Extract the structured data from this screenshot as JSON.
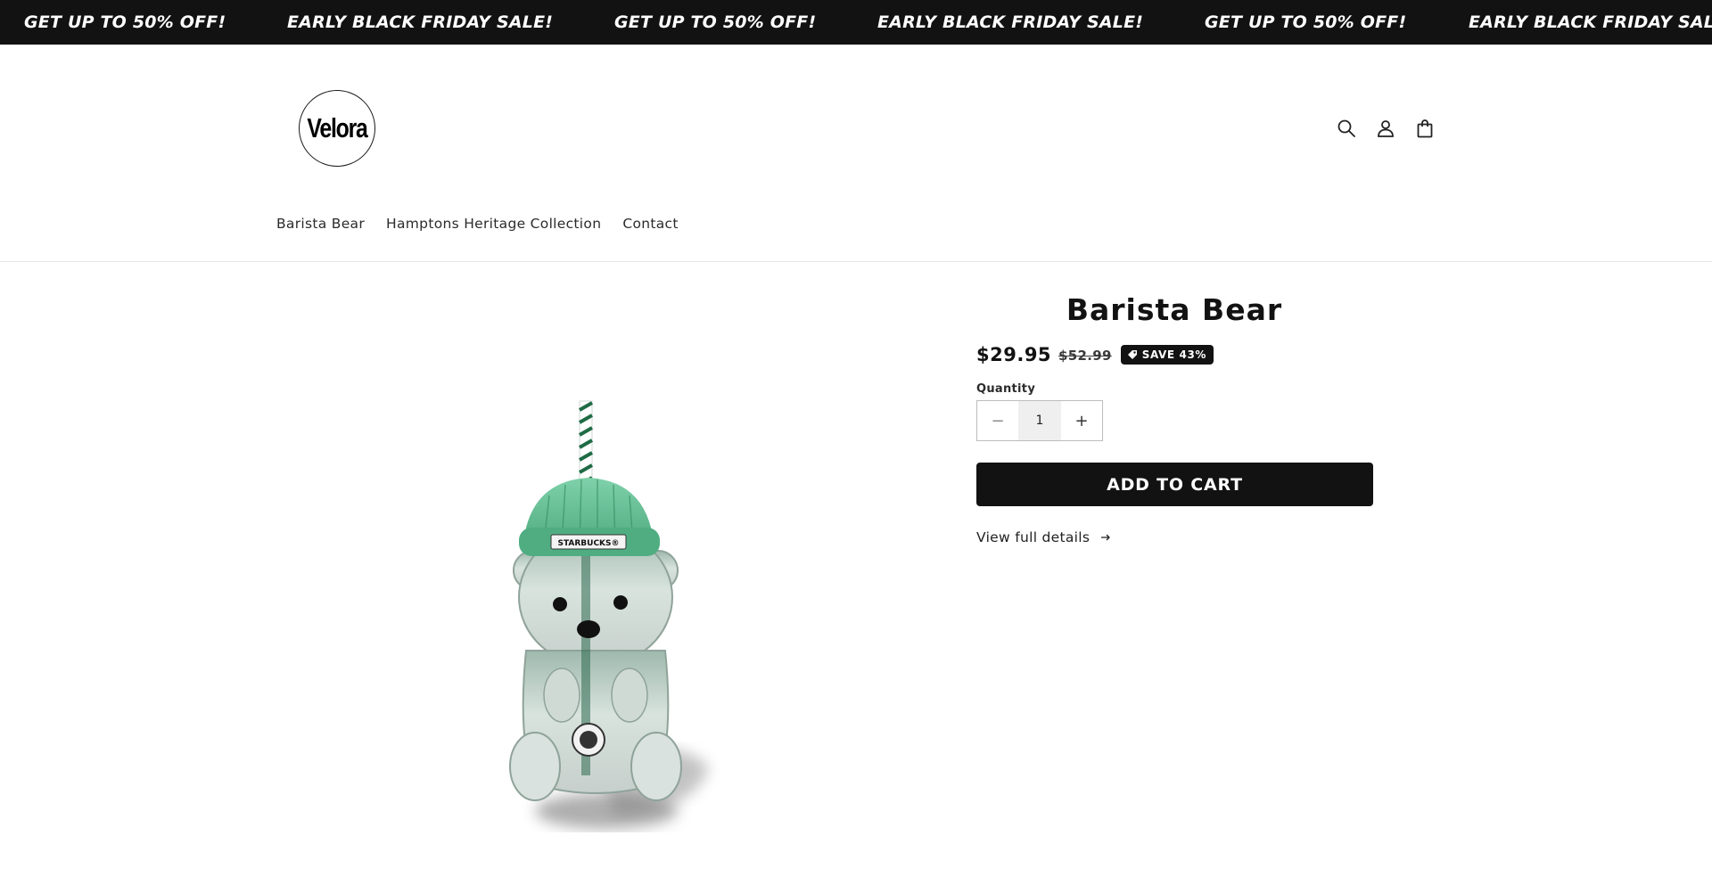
{
  "announcement": {
    "items": [
      "GET UP TO 50% OFF!",
      "EARLY BLACK FRIDAY SALE!",
      "GET UP TO 50% OFF!",
      "EARLY BLACK FRIDAY SALE!",
      "GET UP TO 50% OFF!",
      "EARLY BLACK FRIDAY SALE!"
    ]
  },
  "header": {
    "logo_text": "Velora",
    "icons": [
      "search-icon",
      "account-icon",
      "cart-icon"
    ]
  },
  "nav": {
    "items": [
      {
        "label": "Barista Bear"
      },
      {
        "label": "Hamptons Heritage Collection"
      },
      {
        "label": "Contact"
      }
    ]
  },
  "product": {
    "title": "Barista Bear",
    "price": "$29.95",
    "compare_price": "$52.99",
    "badge": "SAVE 43%",
    "quantity_label": "Quantity",
    "quantity_value": "1",
    "quantity_minus": "−",
    "quantity_plus": "+",
    "add_to_cart": "ADD TO CART",
    "view_details": "View full details",
    "image_label": "STARBUCKS®"
  },
  "colors": {
    "announcement_bg": "#121212",
    "button_bg": "#121212",
    "lid_green": "#6ec9a0",
    "straw_green": "#1f6b45"
  }
}
